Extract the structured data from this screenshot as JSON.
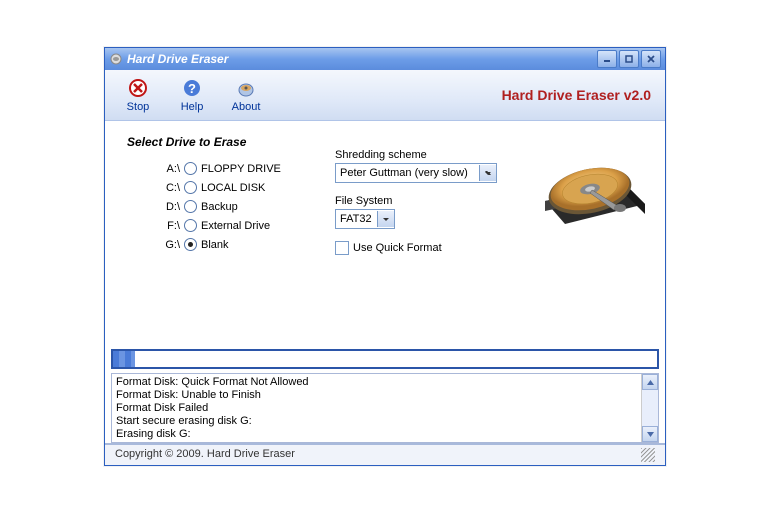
{
  "titlebar": {
    "text": "Hard Drive Eraser"
  },
  "toolbar": {
    "stop": "Stop",
    "help": "Help",
    "about": "About",
    "app_title": "Hard Drive Eraser v2.0"
  },
  "main": {
    "section_title": "Select Drive to Erase",
    "drives": [
      {
        "letter": "A:\\",
        "label": "FLOPPY DRIVE",
        "selected": false
      },
      {
        "letter": "C:\\",
        "label": "LOCAL DISK",
        "selected": false
      },
      {
        "letter": "D:\\",
        "label": "Backup",
        "selected": false
      },
      {
        "letter": "F:\\",
        "label": "External Drive",
        "selected": false
      },
      {
        "letter": "G:\\",
        "label": "Blank",
        "selected": true
      }
    ],
    "scheme_label": "Shredding scheme",
    "scheme_value": "Peter Guttman (very slow)",
    "fs_label": "File System",
    "fs_value": "FAT32",
    "quick_format": "Use Quick Format"
  },
  "log": [
    "Format Disk: Quick Format Not Allowed",
    "Format Disk: Unable to Finish",
    "Format Disk Failed",
    "Start secure erasing disk G:",
    "Erasing disk G:"
  ],
  "status": "Copyright © 2009. Hard Drive Eraser"
}
